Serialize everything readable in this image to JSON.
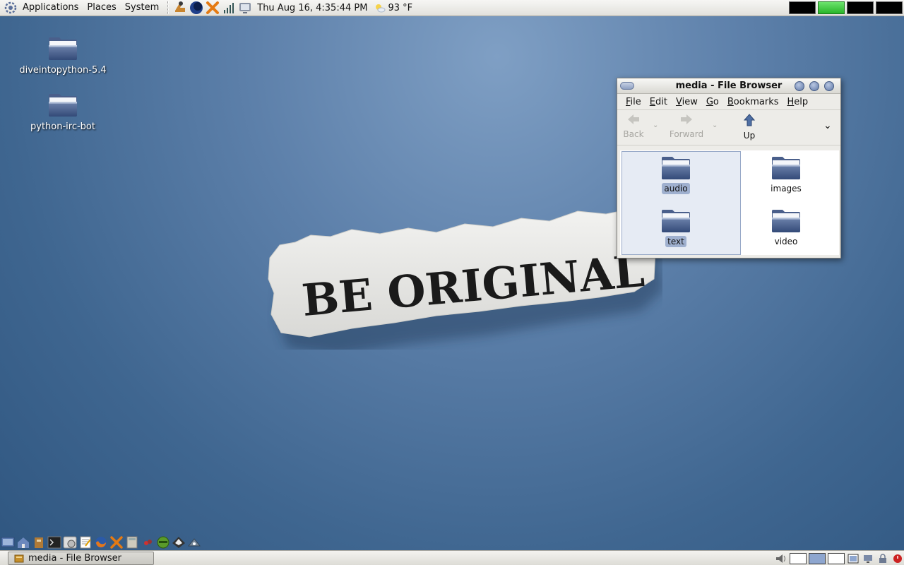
{
  "top_panel": {
    "menus": [
      "Applications",
      "Places",
      "System"
    ],
    "clock": "Thu Aug 16,  4:35:44 PM",
    "weather": "93 °F"
  },
  "desktop": {
    "icons": [
      {
        "label": "diveintopython-5.4"
      },
      {
        "label": "python-irc-bot"
      }
    ],
    "wallpaper_text": "BE ORIGINAL"
  },
  "file_browser": {
    "title": "media - File Browser",
    "menu": [
      {
        "label": "File",
        "mnemonic": "F",
        "rest": "ile"
      },
      {
        "label": "Edit",
        "mnemonic": "E",
        "rest": "dit"
      },
      {
        "label": "View",
        "mnemonic": "V",
        "rest": "iew"
      },
      {
        "label": "Go",
        "mnemonic": "G",
        "rest": "o"
      },
      {
        "label": "Bookmarks",
        "mnemonic": "B",
        "rest": "ookmarks"
      },
      {
        "label": "Help",
        "mnemonic": "H",
        "rest": "elp"
      }
    ],
    "toolbar": {
      "back": "Back",
      "forward": "Forward",
      "up": "Up"
    },
    "items": [
      {
        "name": "audio",
        "selected": true
      },
      {
        "name": "images",
        "selected": false
      },
      {
        "name": "text",
        "selected": true
      },
      {
        "name": "video",
        "selected": false
      }
    ]
  },
  "taskbar": {
    "window_button": "media - File Browser"
  },
  "colors": {
    "folder_dark": "#3f5686",
    "folder_light": "#c9d3e6",
    "selection": "#9fb0cf"
  }
}
